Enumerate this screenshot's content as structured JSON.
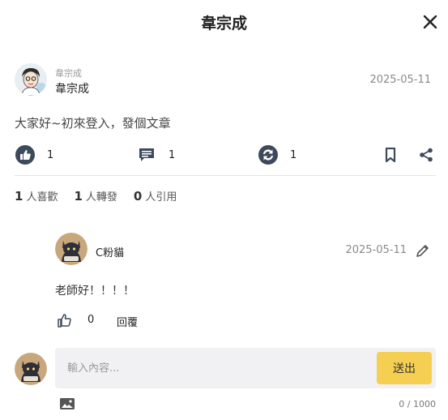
{
  "header": {
    "title": "韋宗成"
  },
  "post": {
    "author_small": "韋宗成",
    "author_name": "韋宗成",
    "date": "2025-05-11",
    "content": "大家好~初來登入，發個文章",
    "like_count": "1",
    "comment_count": "1",
    "share_count": "1"
  },
  "stats": {
    "likes_num": "1",
    "likes_label": "人喜歡",
    "reposts_num": "1",
    "reposts_label": "人轉發",
    "quotes_num": "0",
    "quotes_label": "人引用"
  },
  "comment": {
    "name": "C粉貓",
    "date": "2025-05-11",
    "text": "老師好！！！！",
    "like_count": "0",
    "reply_label": "回覆"
  },
  "composer": {
    "placeholder": "輸入內容...",
    "send_label": "送出",
    "char_count": "0 / 1000"
  },
  "colors": {
    "accent": "#f5cf52",
    "icon": "#3d4a5c"
  },
  "icons": [
    "close-icon",
    "thumbs-up-icon",
    "comment-icon",
    "repost-icon",
    "bookmark-icon",
    "share-icon",
    "edit-icon",
    "image-icon"
  ]
}
